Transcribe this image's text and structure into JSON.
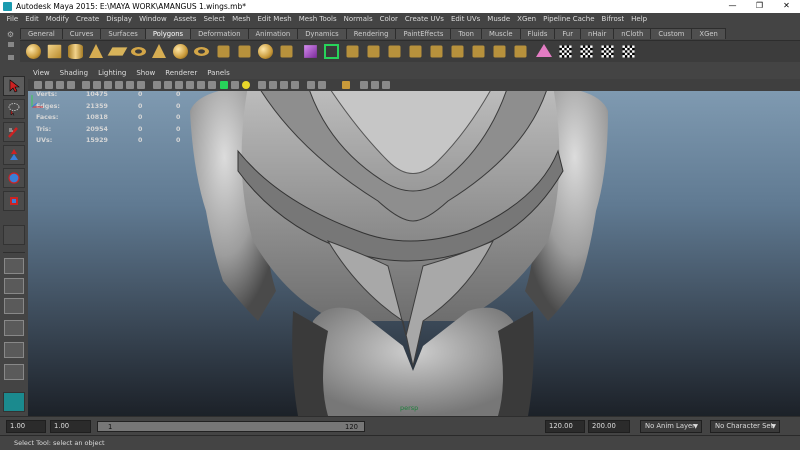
{
  "window": {
    "title": "Autodesk Maya 2015: E:\\MAYA WORK\\AMANGUS 1.wings.mb*",
    "minimize": "—",
    "maximize": "❐",
    "close": "✕"
  },
  "menubar": [
    "File",
    "Edit",
    "Modify",
    "Create",
    "Display",
    "Window",
    "Assets",
    "Select",
    "Mesh",
    "Edit Mesh",
    "Mesh Tools",
    "Normals",
    "Color",
    "Create UVs",
    "Edit UVs",
    "Musde",
    "XGen",
    "Pipeline Cache",
    "Bifrost",
    "Help"
  ],
  "shelf_tabs": [
    "General",
    "Curves",
    "Surfaces",
    "Polygons",
    "Deformation",
    "Animation",
    "Dynamics",
    "Rendering",
    "PaintEffects",
    "Toon",
    "Muscle",
    "Fluids",
    "Fur",
    "nHair",
    "nCloth",
    "Custom",
    "XGen"
  ],
  "active_shelf_tab": "Polygons",
  "panel_menus": [
    "View",
    "Shading",
    "Lighting",
    "Show",
    "Renderer",
    "Panels"
  ],
  "hud": {
    "rows": [
      {
        "label": "Verts:",
        "total": "10475",
        "sel": "0",
        "comp": "0"
      },
      {
        "label": "Edges:",
        "total": "21359",
        "sel": "0",
        "comp": "0"
      },
      {
        "label": "Faces:",
        "total": "10818",
        "sel": "0",
        "comp": "0"
      },
      {
        "label": "Tris:",
        "total": "20954",
        "sel": "0",
        "comp": "0"
      },
      {
        "label": "UVs:",
        "total": "15929",
        "sel": "0",
        "comp": "0"
      }
    ]
  },
  "camera_label": "persp",
  "timeline": {
    "start": "1.00",
    "playback_start": "1.00",
    "range_start": "1",
    "range_end": "120",
    "playback_end": "120.00",
    "end": "200.00",
    "anim_layer": "No Anim Layer",
    "character_set": "No Character Set"
  },
  "help_line": "Select Tool: select an object",
  "colors": {
    "viewport_top": "#7f9ab1",
    "viewport_bottom": "#1c2128",
    "active_green": "#27d35a",
    "hud_text": "#d6d6d6"
  }
}
